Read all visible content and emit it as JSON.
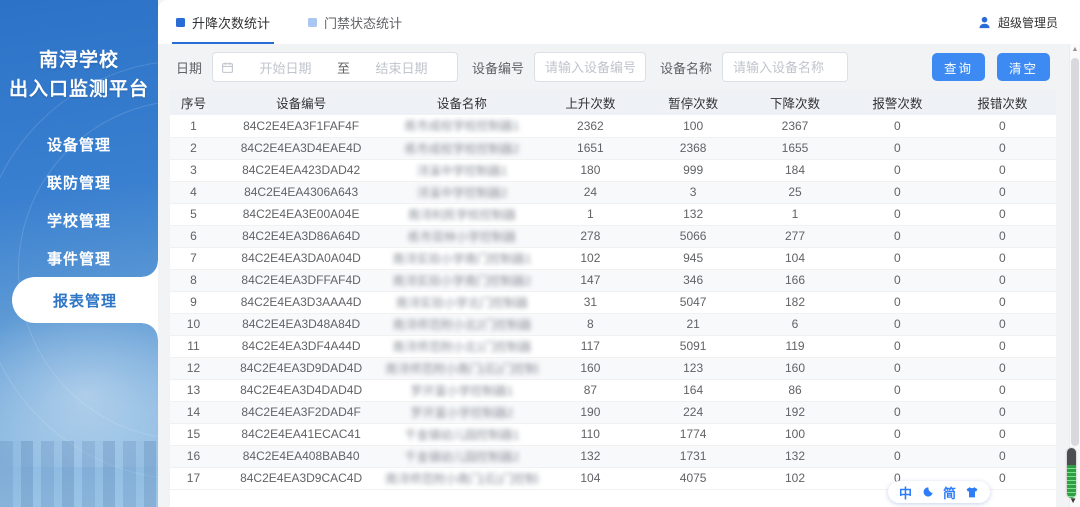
{
  "app": {
    "title_line1": "南浔学校",
    "title_line2": "出入口监测平台"
  },
  "sidebar": {
    "items": [
      {
        "label": "设备管理",
        "active": false
      },
      {
        "label": "联防管理",
        "active": false
      },
      {
        "label": "学校管理",
        "active": false
      },
      {
        "label": "事件管理",
        "active": false
      },
      {
        "label": "报表管理",
        "active": true
      }
    ]
  },
  "header": {
    "tabs": [
      {
        "label": "升降次数统计",
        "active": true
      },
      {
        "label": "门禁状态统计",
        "active": false
      }
    ],
    "user": {
      "name": "超级管理员",
      "icon": "user-icon"
    }
  },
  "filters": {
    "date_label": "日期",
    "date_start_placeholder": "开始日期",
    "date_separator": "至",
    "date_end_placeholder": "结束日期",
    "calendar_icon": "calendar-icon",
    "device_no_label": "设备编号",
    "device_no_placeholder": "请输入设备编号",
    "device_no_value": "",
    "device_name_label": "设备名称",
    "device_name_placeholder": "请输入设备名称",
    "device_name_value": "",
    "search_button": "查询",
    "clear_button": "清空"
  },
  "table": {
    "columns": [
      "序号",
      "设备编号",
      "设备名称",
      "上升次数",
      "暂停次数",
      "下降次数",
      "报警次数",
      "报错次数"
    ],
    "device_name_blurred": true,
    "rows": [
      {
        "seq": "1",
        "device_no": "84C2E4EA3F1FAF4F",
        "device_name": "练市成校学校控制器1",
        "up": "2362",
        "pause": "100",
        "down": "2367",
        "alarm": "0",
        "error": "0"
      },
      {
        "seq": "2",
        "device_no": "84C2E4EA3D4EAE4D",
        "device_name": "练市成校学校控制器2",
        "up": "1651",
        "pause": "2368",
        "down": "1655",
        "alarm": "0",
        "error": "0"
      },
      {
        "seq": "3",
        "device_no": "84C2E4EA423DAD42",
        "device_name": "浔溪中学控制器1",
        "up": "180",
        "pause": "999",
        "down": "184",
        "alarm": "0",
        "error": "0"
      },
      {
        "seq": "4",
        "device_no": "84C2E4EA4306A643",
        "device_name": "浔溪中学控制器2",
        "up": "24",
        "pause": "3",
        "down": "25",
        "alarm": "0",
        "error": "0"
      },
      {
        "seq": "5",
        "device_no": "84C2E4EA3E00A04E",
        "device_name": "南浔利民学校控制器",
        "up": "1",
        "pause": "132",
        "down": "1",
        "alarm": "0",
        "error": "0"
      },
      {
        "seq": "6",
        "device_no": "84C2E4EA3D86A64D",
        "device_name": "练市双林小学控制器",
        "up": "278",
        "pause": "5066",
        "down": "277",
        "alarm": "0",
        "error": "0"
      },
      {
        "seq": "7",
        "device_no": "84C2E4EA3DA0A04D",
        "device_name": "南浔实验小学南门控制器1",
        "up": "102",
        "pause": "945",
        "down": "104",
        "alarm": "0",
        "error": "0"
      },
      {
        "seq": "8",
        "device_no": "84C2E4EA3DFFAF4D",
        "device_name": "南浔实验小学南门控制器2",
        "up": "147",
        "pause": "346",
        "down": "166",
        "alarm": "0",
        "error": "0"
      },
      {
        "seq": "9",
        "device_no": "84C2E4EA3D3AAA4D",
        "device_name": "南浔实验小学北门控制器",
        "up": "31",
        "pause": "5047",
        "down": "182",
        "alarm": "0",
        "error": "0"
      },
      {
        "seq": "10",
        "device_no": "84C2E4EA3D48A84D",
        "device_name": "南浔师范附小北2门控制器",
        "up": "8",
        "pause": "21",
        "down": "6",
        "alarm": "0",
        "error": "0"
      },
      {
        "seq": "11",
        "device_no": "84C2E4EA3DF4A44D",
        "device_name": "南浔师范附小北1门控制器",
        "up": "117",
        "pause": "5091",
        "down": "119",
        "alarm": "0",
        "error": "0"
      },
      {
        "seq": "12",
        "device_no": "84C2E4EA3D9DAD4D",
        "device_name": "南浔师范附小南门(石)门控制器1",
        "up": "160",
        "pause": "123",
        "down": "160",
        "alarm": "0",
        "error": "0"
      },
      {
        "seq": "13",
        "device_no": "84C2E4EA3D4DAD4D",
        "device_name": "罗开富小学控制器1",
        "up": "87",
        "pause": "164",
        "down": "86",
        "alarm": "0",
        "error": "0"
      },
      {
        "seq": "14",
        "device_no": "84C2E4EA3F2DAD4F",
        "device_name": "罗开富小学控制器2",
        "up": "190",
        "pause": "224",
        "down": "192",
        "alarm": "0",
        "error": "0"
      },
      {
        "seq": "15",
        "device_no": "84C2E4EA41ECAC41",
        "device_name": "千金镇幼儿园控制器1",
        "up": "110",
        "pause": "1774",
        "down": "100",
        "alarm": "0",
        "error": "0"
      },
      {
        "seq": "16",
        "device_no": "84C2E4EA408BAB40",
        "device_name": "千金镇幼儿园控制器2",
        "up": "132",
        "pause": "1731",
        "down": "132",
        "alarm": "0",
        "error": "0"
      },
      {
        "seq": "17",
        "device_no": "84C2E4EA3D9CAC4D",
        "device_name": "南浔师范附小南门(石)门控制器2",
        "up": "104",
        "pause": "4075",
        "down": "102",
        "alarm": "0",
        "error": "0"
      }
    ]
  },
  "overlays": {
    "translate_widget": {
      "char1": "中",
      "moon_icon": "moon-icon",
      "char2": "简",
      "shirt_icon": "shirt-icon"
    },
    "scroll_widget_icon": "scroll-progress-widget",
    "scrollbar_up_arrow": "▲",
    "scroll_widget_down_arrow": "▼"
  },
  "colors": {
    "accent": "#2a6cd5",
    "button_blue": "#3d8af2",
    "active_menu_text": "#2e75c8",
    "sidebar_top": "#2c72c7",
    "sidebar_bottom": "#9ec7e8"
  }
}
